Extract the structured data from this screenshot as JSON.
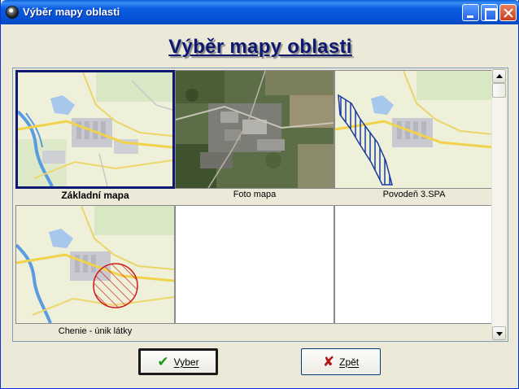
{
  "window": {
    "title": "Výběr mapy oblasti"
  },
  "heading": "Výběr mapy oblasti",
  "maps": [
    {
      "caption": "Základní mapa",
      "selected": true,
      "kind": "base-map"
    },
    {
      "caption": "Foto mapa",
      "selected": false,
      "kind": "aerial-photo"
    },
    {
      "caption": "Povodeň 3.SPA",
      "selected": false,
      "kind": "flood-overlay"
    },
    {
      "caption": "Chenie - únik látky",
      "selected": false,
      "kind": "leak-overlay"
    },
    {
      "caption": "",
      "selected": false,
      "kind": "empty"
    },
    {
      "caption": "",
      "selected": false,
      "kind": "empty"
    }
  ],
  "buttons": {
    "ok_label": "Vyber",
    "back_label": "Zpět"
  },
  "icons": {
    "ok": "check-icon",
    "back": "cross-icon"
  },
  "colors": {
    "titlebar": "#0654d7",
    "heading": "#0d1870",
    "selection_border": "#0d1870",
    "flood_hatch": "#1a3aa0",
    "leak_hatch": "#d01818"
  }
}
